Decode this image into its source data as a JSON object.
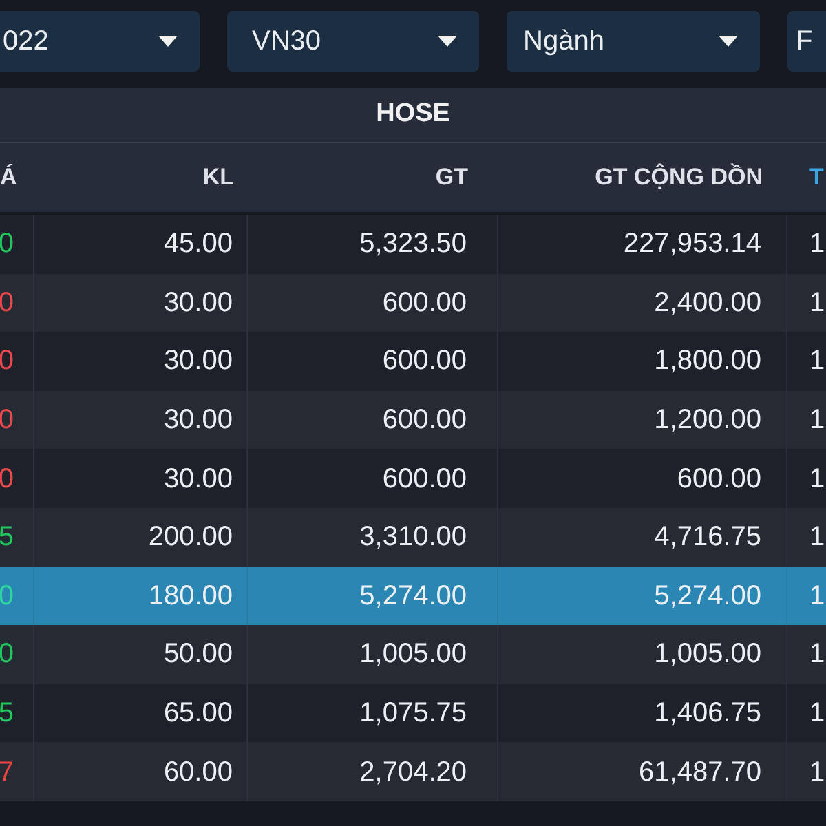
{
  "filters": [
    {
      "value": "022"
    },
    {
      "value": "VN30"
    },
    {
      "value": "Ngành"
    },
    {
      "value": "F"
    }
  ],
  "table": {
    "group_header": "HOSE",
    "columns": [
      {
        "label": "Á"
      },
      {
        "label": "KL"
      },
      {
        "label": "GT"
      },
      {
        "label": "GT CỘNG DỒN"
      },
      {
        "label": "T"
      }
    ],
    "rows": [
      {
        "column_1": "0",
        "color": "#22c55e",
        "kl": "45.00",
        "gt": "5,323.50",
        "gt_cong_don": "227,953.14",
        "column_5": "1",
        "selected": false
      },
      {
        "column_1": "0",
        "color": "#e5484d",
        "kl": "30.00",
        "gt": "600.00",
        "gt_cong_don": "2,400.00",
        "column_5": "1",
        "selected": false
      },
      {
        "column_1": "0",
        "color": "#e5484d",
        "kl": "30.00",
        "gt": "600.00",
        "gt_cong_don": "1,800.00",
        "column_5": "1",
        "selected": false
      },
      {
        "column_1": "0",
        "color": "#e5484d",
        "kl": "30.00",
        "gt": "600.00",
        "gt_cong_don": "1,200.00",
        "column_5": "1",
        "selected": false
      },
      {
        "column_1": "0",
        "color": "#e5484d",
        "kl": "30.00",
        "gt": "600.00",
        "gt_cong_don": "600.00",
        "column_5": "1",
        "selected": false
      },
      {
        "column_1": "5",
        "color": "#22c55e",
        "kl": "200.00",
        "gt": "3,310.00",
        "gt_cong_don": "4,716.75",
        "column_5": "1",
        "selected": false
      },
      {
        "column_1": "0",
        "color": "#2ed3a0",
        "kl": "180.00",
        "gt": "5,274.00",
        "gt_cong_don": "5,274.00",
        "column_5": "1",
        "selected": true
      },
      {
        "column_1": "0",
        "color": "#22c55e",
        "kl": "50.00",
        "gt": "1,005.00",
        "gt_cong_don": "1,005.00",
        "column_5": "1",
        "selected": false
      },
      {
        "column_1": "5",
        "color": "#22c55e",
        "kl": "65.00",
        "gt": "1,075.75",
        "gt_cong_don": "1,406.75",
        "column_5": "1",
        "selected": false
      },
      {
        "column_1": "7",
        "color": "#ef4444",
        "kl": "60.00",
        "gt": "2,704.20",
        "gt_cong_don": "61,487.70",
        "column_5": "1",
        "selected": false
      }
    ]
  }
}
